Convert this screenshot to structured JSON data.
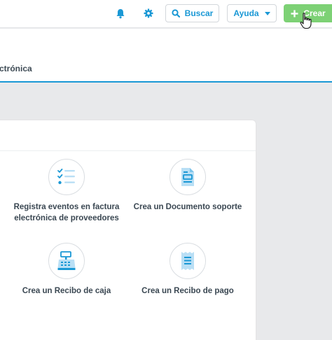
{
  "topbar": {
    "search_label": "Buscar",
    "help_label": "Ayuda",
    "create_label": "Crear"
  },
  "subheader": {
    "title": "ctrónica"
  },
  "options": [
    {
      "label": "Registra eventos en factura electrónica de proveedores",
      "icon": "checklist-icon"
    },
    {
      "label": "Crea un Documento soporte",
      "icon": "document-icon"
    },
    {
      "label": "Crea un Recibo de caja",
      "icon": "cash-register-icon"
    },
    {
      "label": "Crea un Recibo de pago",
      "icon": "receipt-icon"
    }
  ],
  "colors": {
    "accent": "#1a98d5",
    "create_button": "#7dd175",
    "icon_light": "#b9dff5",
    "background": "#e8e9eb"
  }
}
